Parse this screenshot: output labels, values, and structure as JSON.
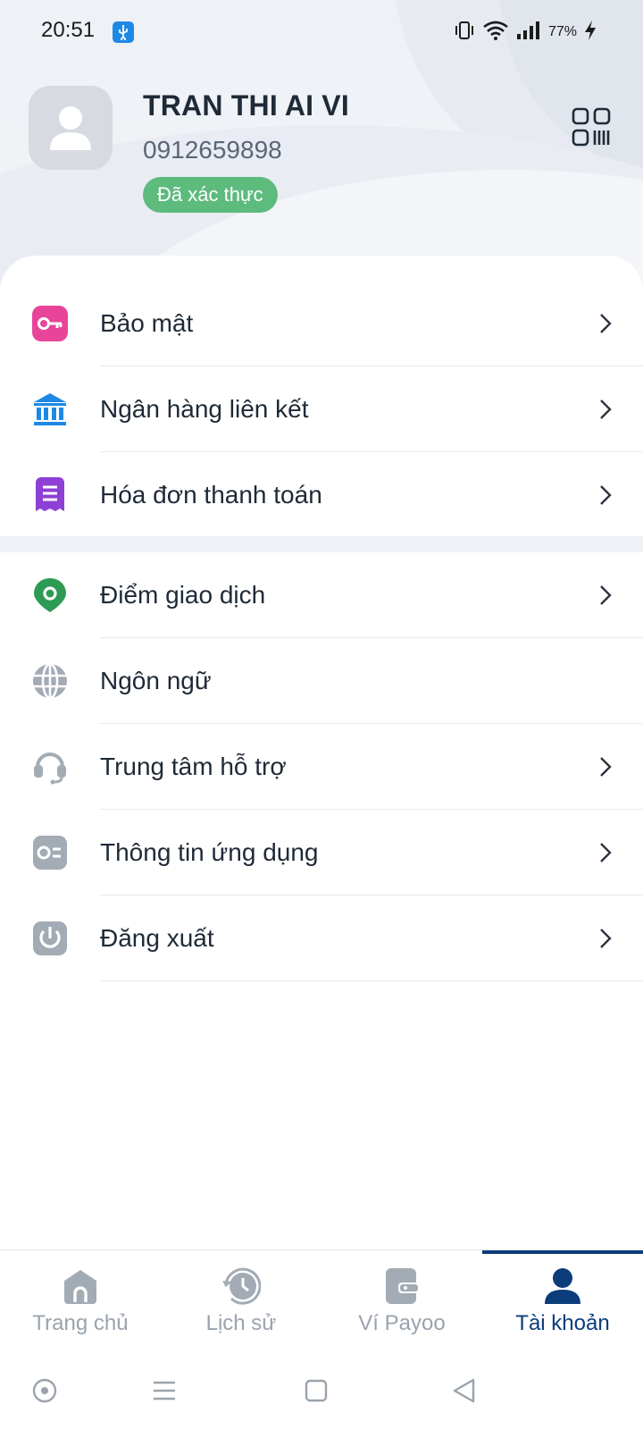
{
  "status_bar": {
    "time": "20:51",
    "battery": "77%"
  },
  "profile": {
    "name": "TRAN THI AI VI",
    "phone": "0912659898",
    "verified_label": "Đã xác thực"
  },
  "menu": {
    "items": [
      {
        "label": "Bảo mật",
        "icon": "key-icon"
      },
      {
        "label": "Ngân hàng liên kết",
        "icon": "bank-icon"
      },
      {
        "label": "Hóa đơn thanh toán",
        "icon": "bill-icon"
      },
      {
        "label": "Điểm giao dịch",
        "icon": "location-pin-icon"
      },
      {
        "label": "Ngôn ngữ",
        "icon": "globe-icon"
      },
      {
        "label": "Trung tâm hỗ trợ",
        "icon": "headset-icon"
      },
      {
        "label": "Thông tin ứng dụng",
        "icon": "info-card-icon"
      },
      {
        "label": "Đăng xuất",
        "icon": "power-icon"
      }
    ]
  },
  "bottom_nav": {
    "tabs": [
      {
        "label": "Trang chủ",
        "icon": "home-icon"
      },
      {
        "label": "Lịch sử",
        "icon": "history-icon"
      },
      {
        "label": "Ví Payoo",
        "icon": "wallet-icon"
      },
      {
        "label": "Tài khoản",
        "icon": "account-icon",
        "active": true
      }
    ]
  },
  "colors": {
    "brand": "#0b3d7a",
    "verified": "#5dbb7d",
    "inactive": "#9aa3ad"
  }
}
